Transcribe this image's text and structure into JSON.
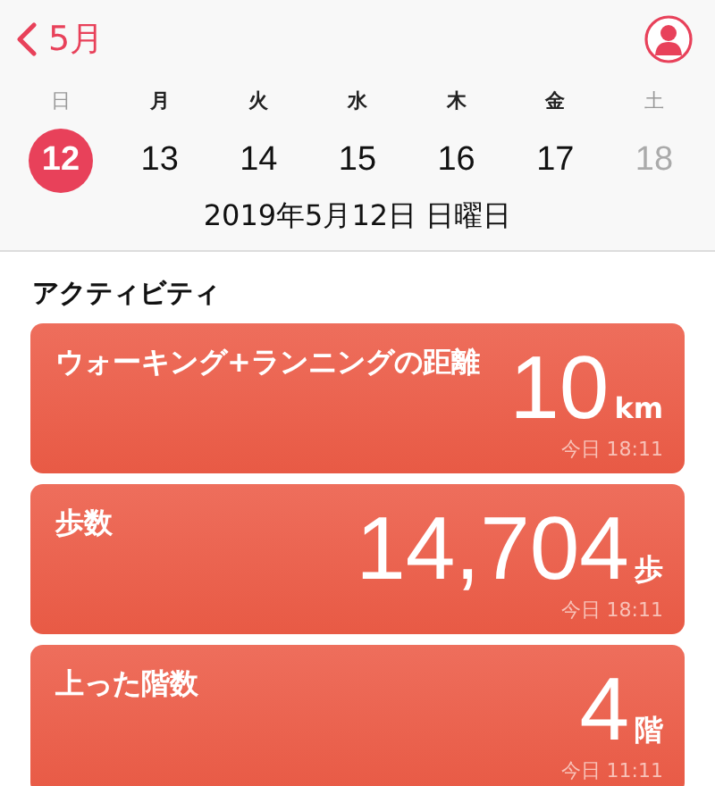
{
  "nav": {
    "back_label": "5月"
  },
  "week": [
    {
      "weekday": "日",
      "date": "12",
      "selected": true,
      "disabled": false,
      "dimmed": true
    },
    {
      "weekday": "月",
      "date": "13",
      "selected": false,
      "disabled": false,
      "dimmed": false
    },
    {
      "weekday": "火",
      "date": "14",
      "selected": false,
      "disabled": false,
      "dimmed": false
    },
    {
      "weekday": "水",
      "date": "15",
      "selected": false,
      "disabled": false,
      "dimmed": false
    },
    {
      "weekday": "木",
      "date": "16",
      "selected": false,
      "disabled": false,
      "dimmed": false
    },
    {
      "weekday": "金",
      "date": "17",
      "selected": false,
      "disabled": false,
      "dimmed": false
    },
    {
      "weekday": "土",
      "date": "18",
      "selected": false,
      "disabled": true,
      "dimmed": true
    }
  ],
  "selected_date": "2019年5月12日 日曜日",
  "section_title": "アクティビティ",
  "cards": [
    {
      "title": "ウォーキング+ランニングの距離",
      "value": "10",
      "unit": "km",
      "time": "今日 18:11"
    },
    {
      "title": "歩数",
      "value": "14,704",
      "unit": "歩",
      "time": "今日 18:11"
    },
    {
      "title": "上った階数",
      "value": "4",
      "unit": "階",
      "time": "今日 11:11"
    }
  ]
}
